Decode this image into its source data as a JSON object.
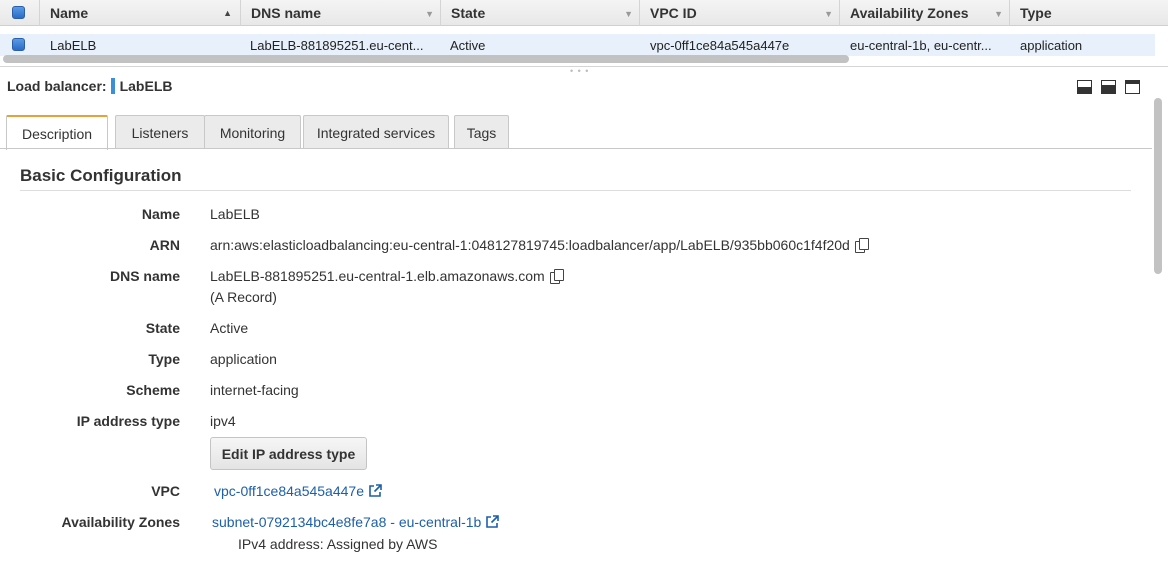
{
  "table": {
    "columns": [
      {
        "label": "Name"
      },
      {
        "label": "DNS name"
      },
      {
        "label": "State"
      },
      {
        "label": "VPC ID"
      },
      {
        "label": "Availability Zones"
      },
      {
        "label": "Type"
      }
    ],
    "row": {
      "name": "LabELB",
      "dns": "LabELB-881895251.eu-cent...",
      "state": "Active",
      "vpc": "vpc-0ff1ce84a545a447e",
      "az": "eu-central-1b, eu-centr...",
      "type": "application"
    }
  },
  "panel": {
    "title_label": "Load balancer:",
    "title_value": "LabELB",
    "tabs": [
      "Description",
      "Listeners",
      "Monitoring",
      "Integrated services",
      "Tags"
    ],
    "active_tab": "Description",
    "section_title": "Basic Configuration",
    "fields": {
      "name": {
        "label": "Name",
        "value": "LabELB"
      },
      "arn": {
        "label": "ARN",
        "value": "arn:aws:elasticloadbalancing:eu-central-1:048127819745:loadbalancer/app/LabELB/935bb060c1f4f20d"
      },
      "dns": {
        "label": "DNS name",
        "value": "LabELB-881895251.eu-central-1.elb.amazonaws.com",
        "note": "(A Record)"
      },
      "state": {
        "label": "State",
        "value": "Active"
      },
      "type": {
        "label": "Type",
        "value": "application"
      },
      "scheme": {
        "label": "Scheme",
        "value": "internet-facing"
      },
      "ip_type": {
        "label": "IP address type",
        "value": "ipv4"
      },
      "vpc": {
        "label": "VPC",
        "value": "vpc-0ff1ce84a545a447e"
      },
      "az": {
        "label": "Availability Zones",
        "value": "subnet-0792134bc4e8fe7a8 - eu-central-1b",
        "note": "IPv4 address: Assigned by AWS"
      }
    },
    "edit_button": "Edit IP address type"
  }
}
